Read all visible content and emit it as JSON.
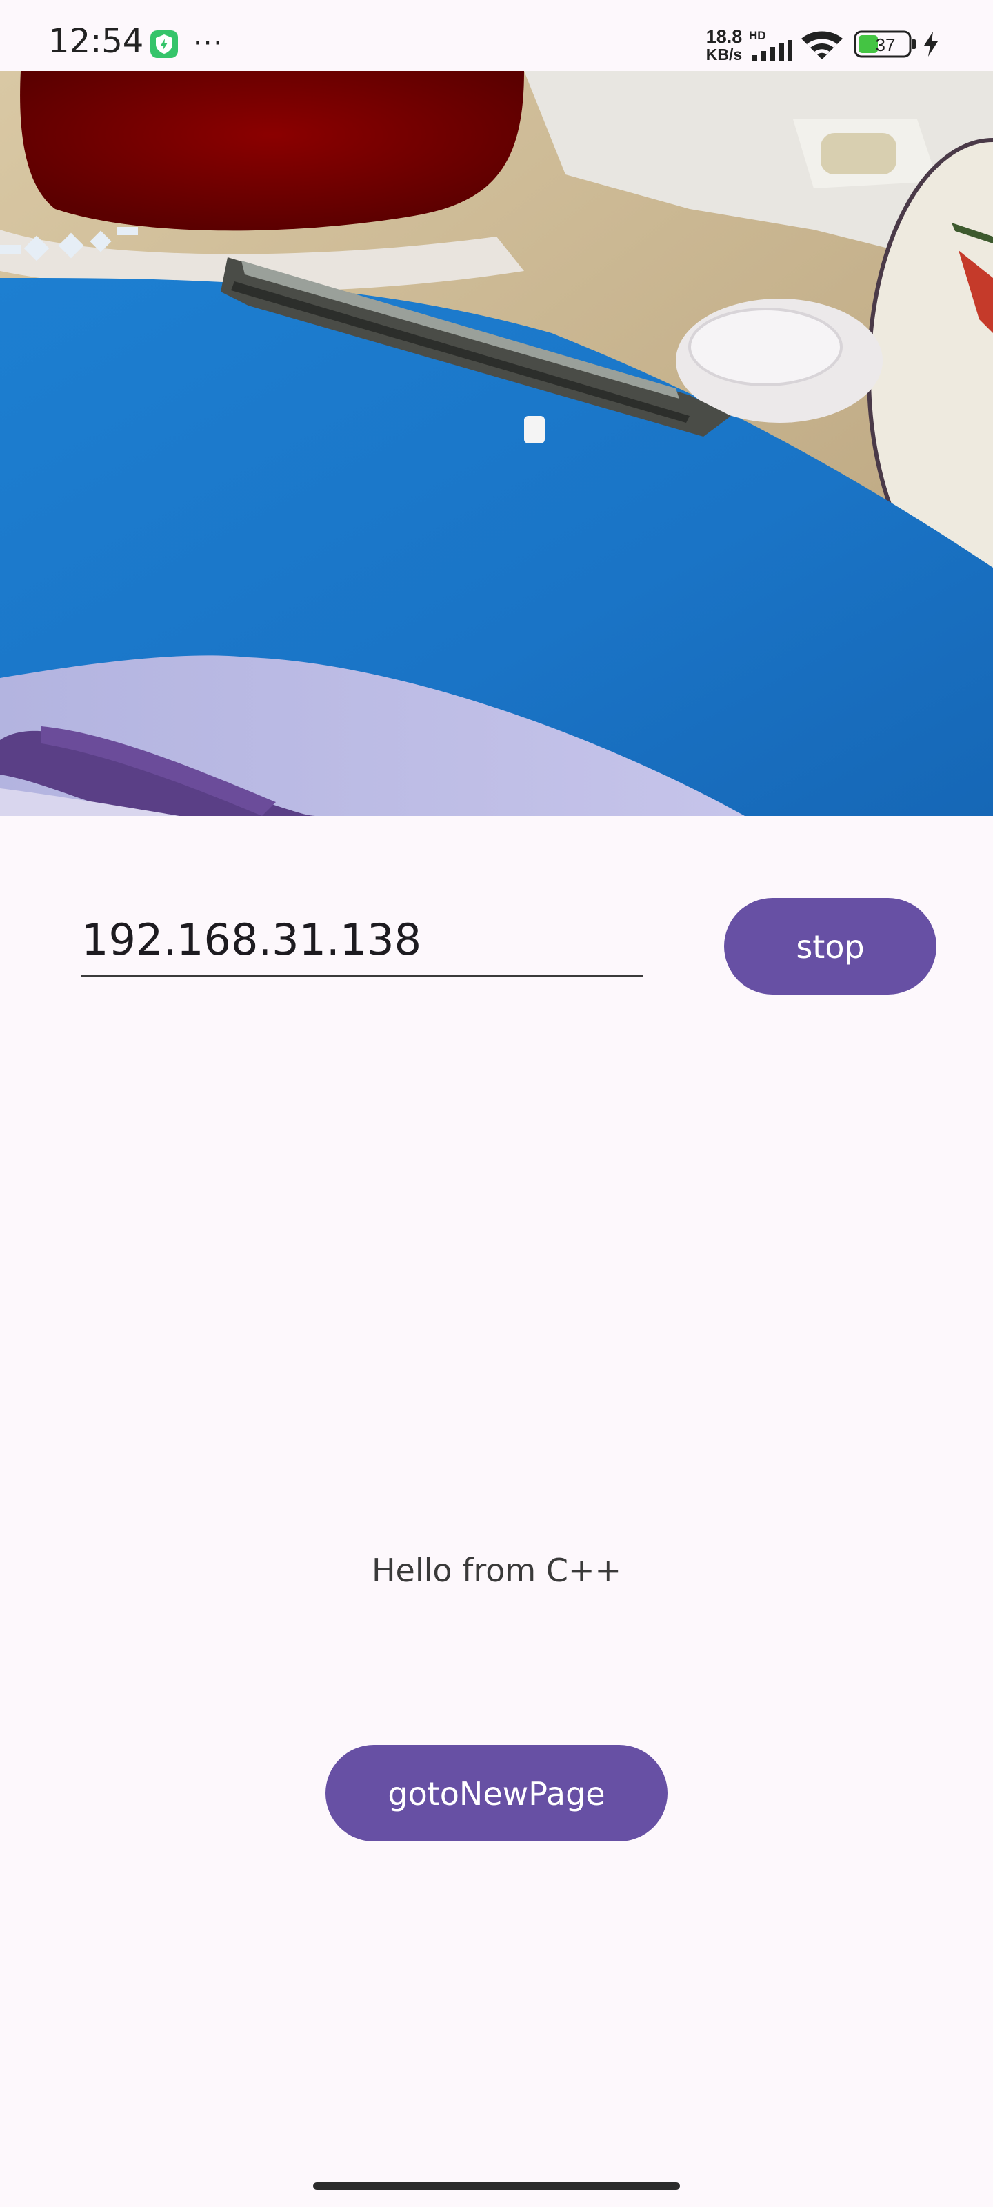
{
  "status_bar": {
    "time": "12:54",
    "more": "···",
    "net_speed_value": "18.8",
    "net_speed_unit": "KB/s",
    "network_type": "HD",
    "battery_level": "37",
    "icons": [
      "shield-app-icon",
      "signal-icon",
      "wifi-icon",
      "battery-icon",
      "charging-icon"
    ]
  },
  "camera_preview": {
    "description_icon": "camera-stream-frame"
  },
  "controls": {
    "ip_address_value": "192.168.31.138",
    "stop_label": "stop"
  },
  "main": {
    "hello_text": "Hello from C++",
    "goto_label": "gotoNewPage"
  },
  "colors": {
    "accent": "#6750a4",
    "background": "#fdf8fc",
    "text": "#1d1b20"
  }
}
